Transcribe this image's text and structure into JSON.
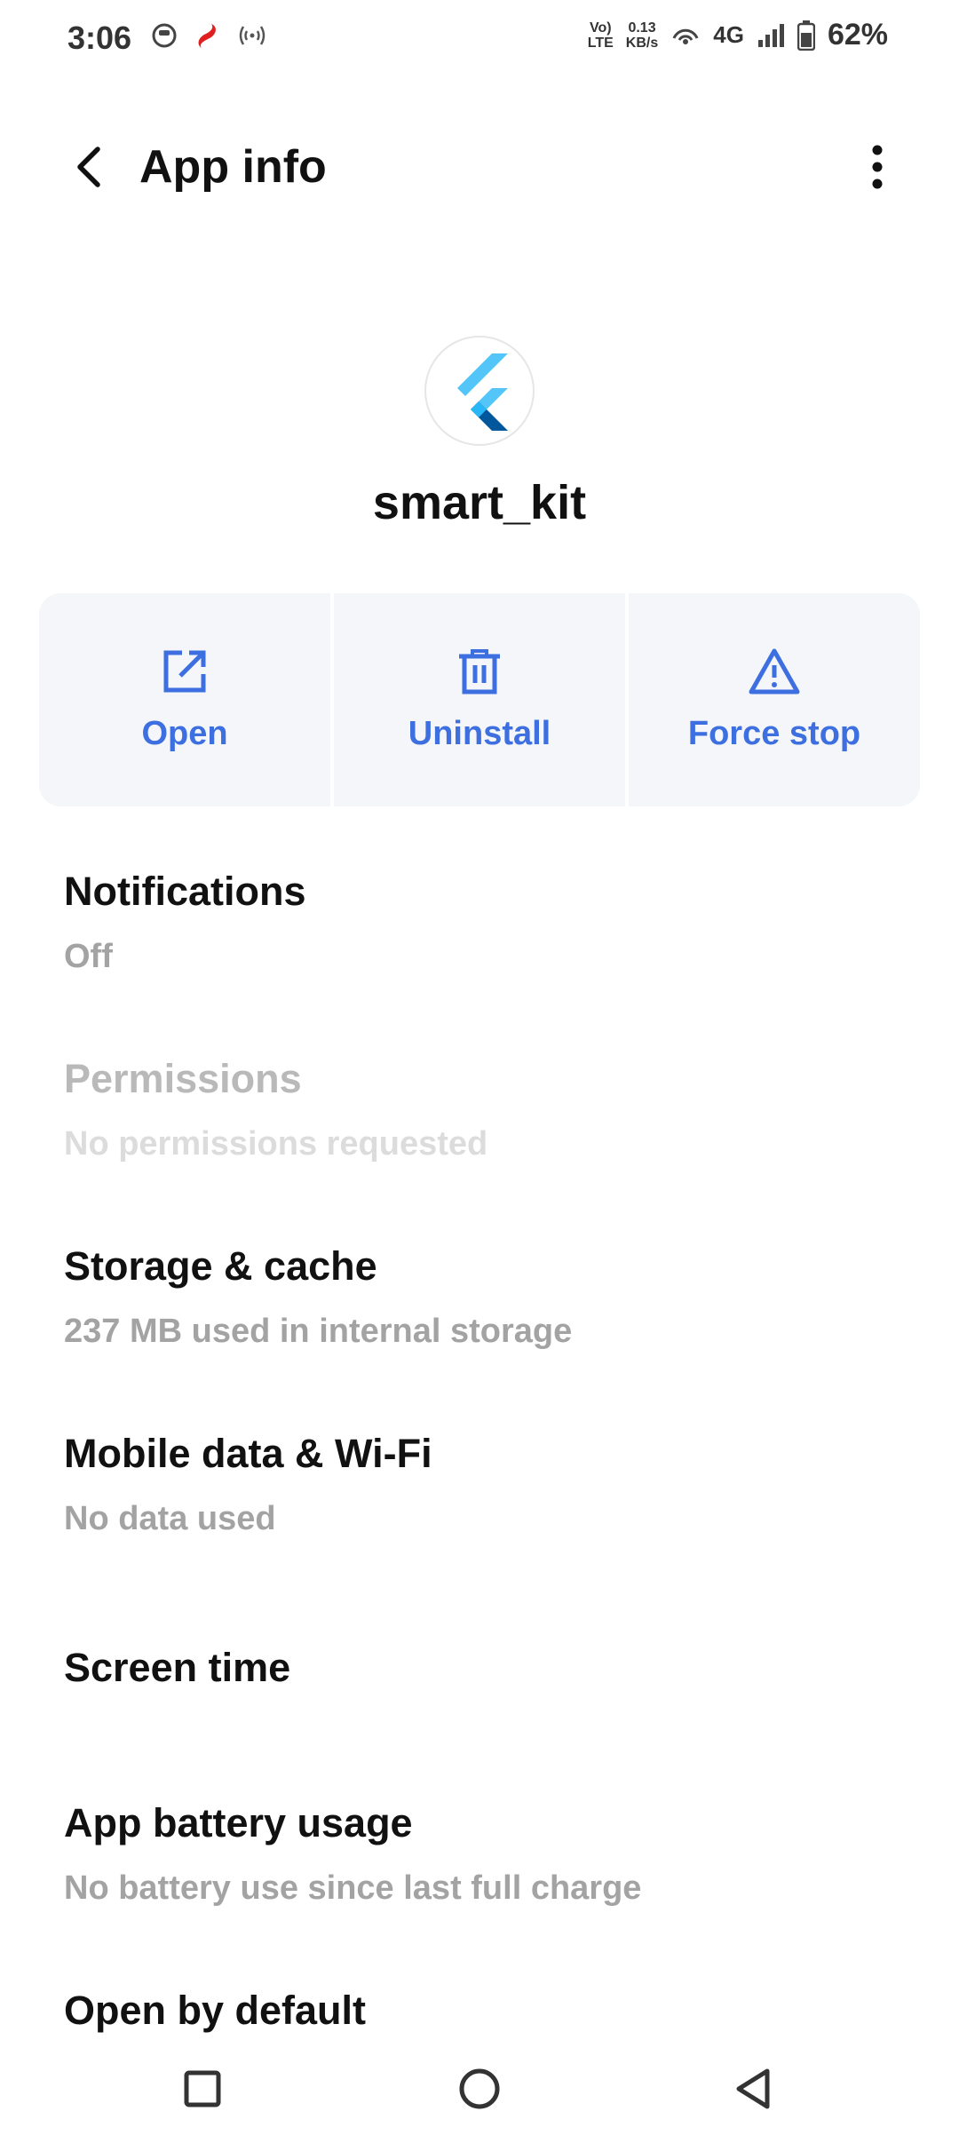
{
  "status_bar": {
    "time": "3:06",
    "volte_top": "Vo)",
    "volte_bottom": "LTE",
    "speed_value": "0.13",
    "speed_unit": "KB/s",
    "network": "4G",
    "battery": "62%"
  },
  "app_bar": {
    "title": "App info"
  },
  "app": {
    "name": "smart_kit"
  },
  "actions": [
    {
      "label": "Open",
      "icon": "open-external-icon"
    },
    {
      "label": "Uninstall",
      "icon": "trash-icon"
    },
    {
      "label": "Force stop",
      "icon": "warning-icon"
    }
  ],
  "settings": [
    {
      "title": "Notifications",
      "subtitle": "Off"
    },
    {
      "title": "Permissions",
      "subtitle": "No permissions requested"
    },
    {
      "title": "Storage & cache",
      "subtitle": "237 MB used in internal storage"
    },
    {
      "title": "Mobile data & Wi-Fi",
      "subtitle": "No data used"
    },
    {
      "title": "Screen time"
    },
    {
      "title": "App battery usage",
      "subtitle": "No battery use since last full charge"
    },
    {
      "title": "Open by default"
    }
  ],
  "colors": {
    "accent": "#3d6fe0",
    "action_bg": "#f4f6fa",
    "secondary_text": "#a3a3a3"
  }
}
